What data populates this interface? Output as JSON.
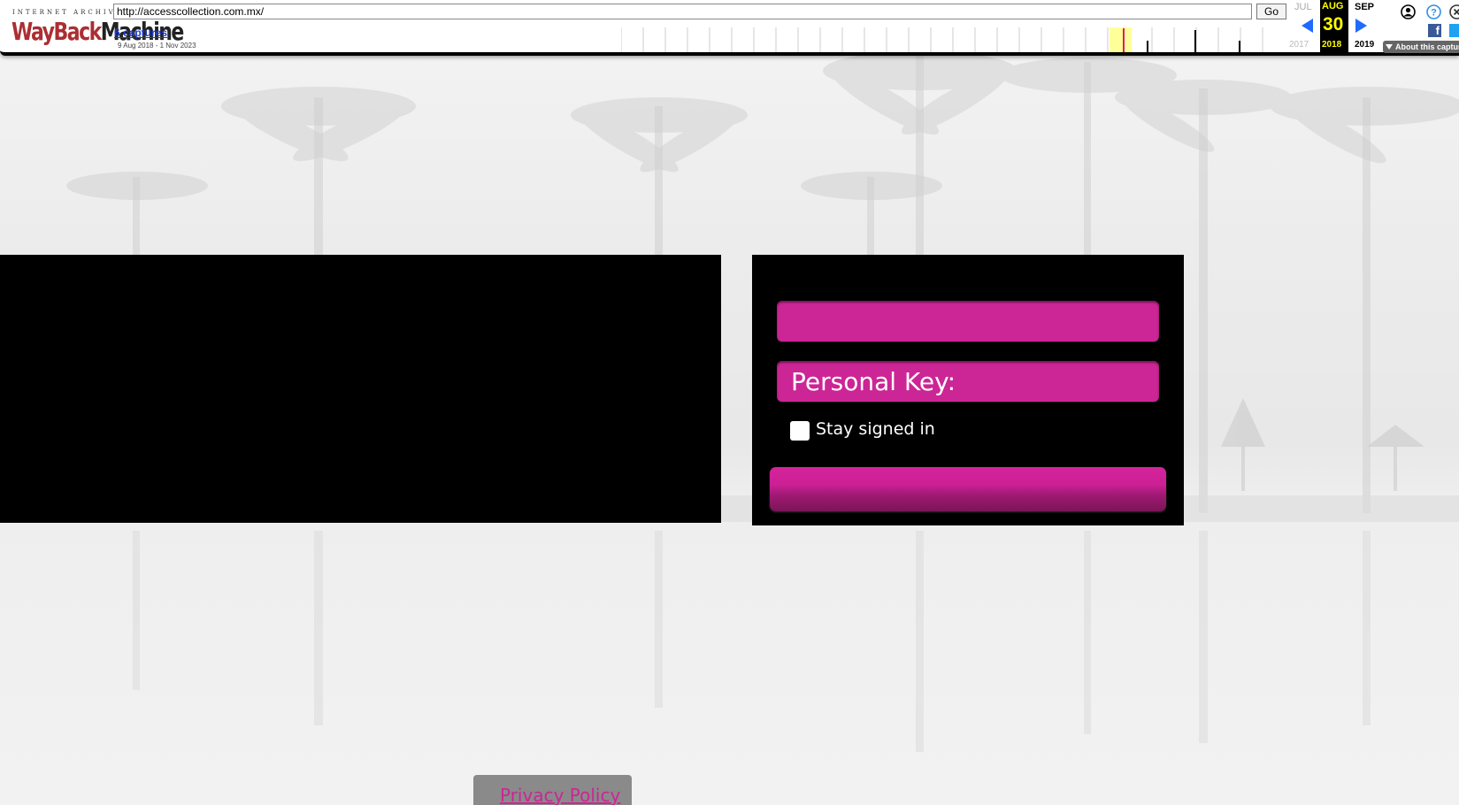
{
  "wayback": {
    "logo_top_text": "INTERNET ARCHIVE",
    "logo_main_text_a": "WayBack",
    "logo_main_text_b": "Machine",
    "url": "http://accesscollection.com.mx/",
    "go_label": "Go",
    "captures_label": "6 captures",
    "date_range": "9 Aug 2018 - 1 Nov 2023",
    "prev_month": "JUL",
    "current_month": "AUG",
    "next_month": "SEP",
    "current_day": "30",
    "prev_year": "2017",
    "current_year": "2018",
    "next_year": "2019",
    "about_label": "About this capture",
    "facebook_glyph": "f",
    "icons": [
      "logo-icon",
      "prev-arrow-icon",
      "next-arrow-icon",
      "user-icon",
      "help-icon",
      "close-icon",
      "facebook-icon",
      "twitter-icon"
    ]
  },
  "login": {
    "username_label": "",
    "personal_key_label": "Personal Key:",
    "stay_signed_in_label": "Stay signed in",
    "stay_signed_in_checked": false,
    "submit_label": ""
  },
  "footer": {
    "privacy_label": "Privacy Policy"
  },
  "colors": {
    "accent": "#cc2595",
    "panel": "#000000",
    "calendar_highlight": "#ffff00",
    "arrow": "#1f6bff"
  }
}
